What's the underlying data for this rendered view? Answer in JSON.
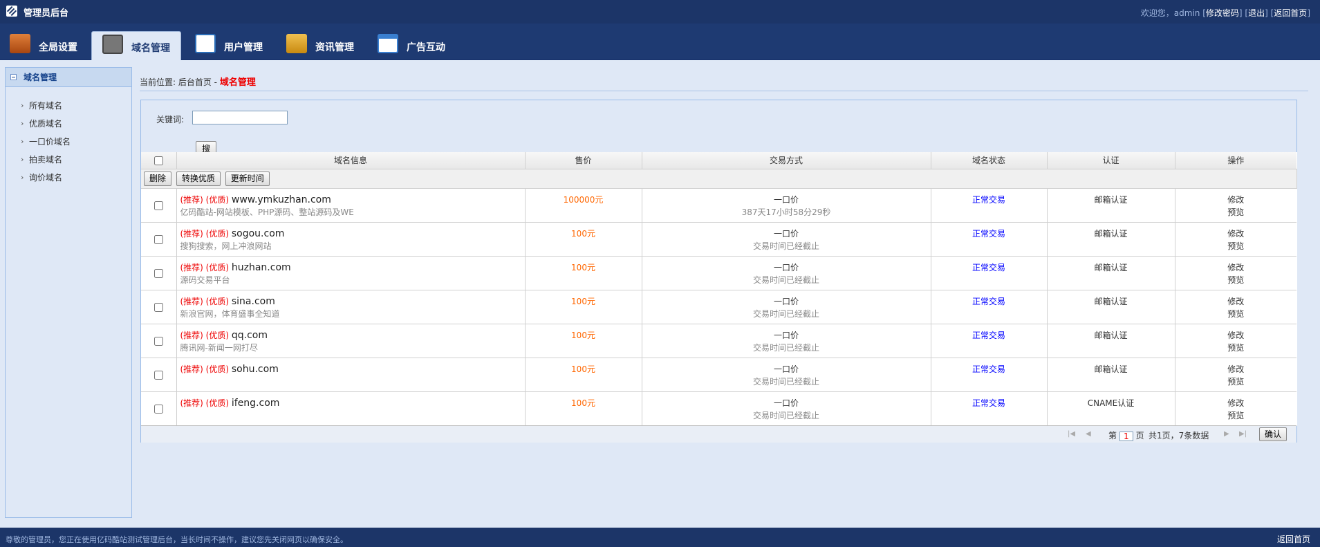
{
  "header": {
    "title": "管理员后台",
    "welcome": "欢迎您，admin",
    "links": [
      "修改密码",
      "退出",
      "返回首页"
    ]
  },
  "nav": {
    "tabs": [
      {
        "label": "全局设置",
        "icon": "settings-box-icon",
        "color": "#c85a1a"
      },
      {
        "label": "域名管理",
        "icon": "grid-icon",
        "color": "#555555",
        "active": true
      },
      {
        "label": "用户管理",
        "icon": "user-card-icon",
        "color": "#2a6db8"
      },
      {
        "label": "资讯管理",
        "icon": "folder-icon",
        "color": "#d49a22"
      },
      {
        "label": "广告互动",
        "icon": "window-list-icon",
        "color": "#3a7fd0"
      }
    ]
  },
  "sidebar": {
    "title": "域名管理",
    "items": [
      "所有域名",
      "优质域名",
      "一口价域名",
      "拍卖域名",
      "询价域名"
    ]
  },
  "breadcrumb": {
    "prefix": "当前位置: 后台首页 - ",
    "current": "域名管理"
  },
  "search": {
    "label": "关键词:",
    "value": "",
    "button": "搜索"
  },
  "table": {
    "headers": [
      "",
      "域名信息",
      "售价",
      "交易方式",
      "域名状态",
      "认证",
      "操作"
    ],
    "toolbar": [
      "删除",
      "转换优质",
      "更新时间"
    ],
    "rows": [
      {
        "tags": "(推荐) (优质)",
        "domain": "www.ymkuzhan.com",
        "desc": "亿码酷站-网站模板、PHP源码、整站源码及WE",
        "price": "100000元",
        "mode": "一口价",
        "mode_sub": "387天17小时58分29秒",
        "status": "正常交易",
        "auth": "邮箱认证",
        "op1": "修改",
        "op2": "预览"
      },
      {
        "tags": "(推荐) (优质)",
        "domain": "sogou.com",
        "desc": "搜狗搜索，网上冲浪网站",
        "price": "100元",
        "mode": "一口价",
        "mode_sub": "交易时间已经截止",
        "status": "正常交易",
        "auth": "邮箱认证",
        "op1": "修改",
        "op2": "预览"
      },
      {
        "tags": "(推荐) (优质)",
        "domain": "huzhan.com",
        "desc": "源码交易平台",
        "price": "100元",
        "mode": "一口价",
        "mode_sub": "交易时间已经截止",
        "status": "正常交易",
        "auth": "邮箱认证",
        "op1": "修改",
        "op2": "预览"
      },
      {
        "tags": "(推荐) (优质)",
        "domain": "sina.com",
        "desc": "新浪官网，体育盛事全知道",
        "price": "100元",
        "mode": "一口价",
        "mode_sub": "交易时间已经截止",
        "status": "正常交易",
        "auth": "邮箱认证",
        "op1": "修改",
        "op2": "预览"
      },
      {
        "tags": "(推荐) (优质)",
        "domain": "qq.com",
        "desc": "腾讯网-新闻一网打尽",
        "price": "100元",
        "mode": "一口价",
        "mode_sub": "交易时间已经截止",
        "status": "正常交易",
        "auth": "邮箱认证",
        "op1": "修改",
        "op2": "预览"
      },
      {
        "tags": "(推荐) (优质)",
        "domain": "sohu.com",
        "desc": "",
        "price": "100元",
        "mode": "一口价",
        "mode_sub": "交易时间已经截止",
        "status": "正常交易",
        "auth": "邮箱认证",
        "op1": "修改",
        "op2": "预览"
      },
      {
        "tags": "(推荐) (优质)",
        "domain": "ifeng.com",
        "desc": "",
        "price": "100元",
        "mode": "一口价",
        "mode_sub": "交易时间已经截止",
        "status": "正常交易",
        "auth": "CNAME认证",
        "op1": "修改",
        "op2": "预览"
      }
    ]
  },
  "pager": {
    "page_prefix": "第",
    "page": "1",
    "page_suffix": "页",
    "summary": "共1页，7条数据",
    "confirm": "确认"
  },
  "footer": {
    "message": "尊敬的管理员，您正在使用亿码酷站测试管理后台，当长时间不操作，建议您先关闭网页以确保安全。",
    "back": "返回首页"
  }
}
